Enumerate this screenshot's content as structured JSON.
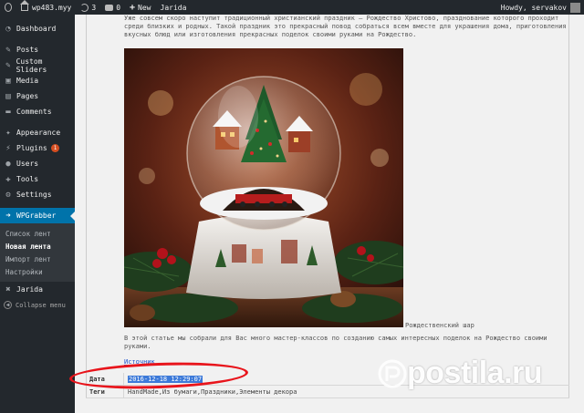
{
  "adminbar": {
    "site_name": "wp483.myy",
    "updates_count": "3",
    "comments_count": "0",
    "new_label": "New",
    "theme_label": "Jarida",
    "howdy": "Howdy, servakov"
  },
  "sidebar": {
    "items": [
      {
        "label": "Dashboard",
        "icon": "dashboard-icon"
      },
      {
        "label": "Posts",
        "icon": "pin-icon"
      },
      {
        "label": "Custom Sliders",
        "icon": "pin-icon"
      },
      {
        "label": "Media",
        "icon": "media-icon"
      },
      {
        "label": "Pages",
        "icon": "page-icon"
      },
      {
        "label": "Comments",
        "icon": "comment-icon"
      },
      {
        "label": "Appearance",
        "icon": "brush-icon"
      },
      {
        "label": "Plugins",
        "icon": "plug-icon",
        "badge": "1"
      },
      {
        "label": "Users",
        "icon": "user-icon"
      },
      {
        "label": "Tools",
        "icon": "wrench-icon"
      },
      {
        "label": "Settings",
        "icon": "settings-icon"
      },
      {
        "label": "WPGrabber",
        "icon": "arrow-icon"
      }
    ],
    "submenu": [
      "Список лент",
      "Новая лента",
      "Импорт лент",
      "Настройки"
    ],
    "jarida": "Jarida",
    "collapse": "Collapse menu"
  },
  "post": {
    "intro": "Уже совсем скоро наступит традиционный христианский праздник – Рождество Христово, празднование которого проходит среди близких и родных. Такой праздник это прекрасный повод собраться всем вместе для украшения дома, приготовления вкусных блюд или изготовления прекрасных поделок своими руками на Рождество.",
    "caption": "Рождественский шар",
    "para2": "В этой статье мы собрали для Вас много мастер-классов по созданию самых интересных поделок на Рождество своими руками.",
    "source": "Источник"
  },
  "meta": {
    "date_label": "Дата",
    "date_value": "2016-12-18 12:29:07",
    "tags_label": "Теги",
    "tags_value": "HandMade,Из бумаги,Праздники,Элементы декора"
  },
  "watermark": {
    "text": "postila.ru"
  },
  "colors": {
    "adminbar_bg": "#23282d",
    "accent": "#0073aa",
    "highlight": "#e8141b",
    "selection": "#3d7ad9"
  }
}
